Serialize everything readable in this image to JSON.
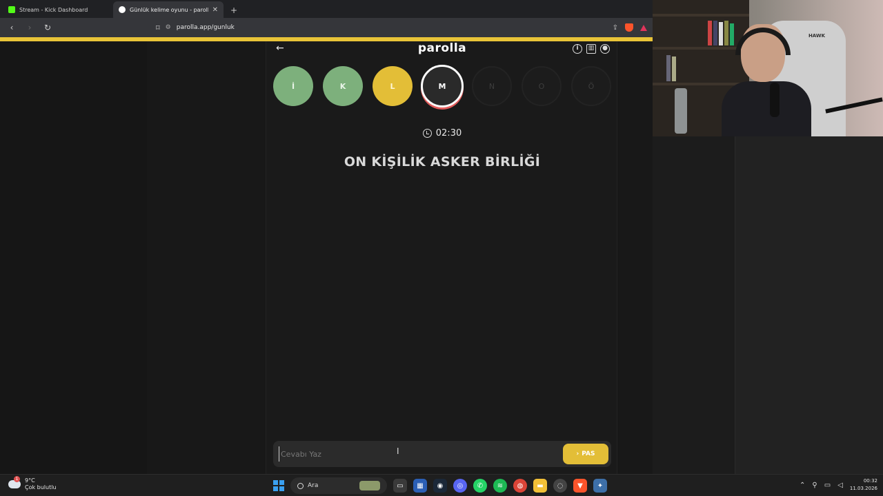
{
  "browser": {
    "tabs": [
      {
        "title": "Stream - Kick Dashboard",
        "active": false
      },
      {
        "title": "Günlük kelime oyunu - parolla -",
        "active": true
      }
    ],
    "new_tab": "+",
    "url": "parolla.app/gunluk"
  },
  "game": {
    "logo": "parolla",
    "letters": [
      {
        "char": "İ",
        "state": "correct"
      },
      {
        "char": "K",
        "state": "correct"
      },
      {
        "char": "L",
        "state": "passed"
      },
      {
        "char": "M",
        "state": "active"
      },
      {
        "char": "N",
        "state": "empty"
      },
      {
        "char": "O",
        "state": "empty"
      },
      {
        "char": "Ö",
        "state": "empty"
      }
    ],
    "timer": "02:30",
    "question": "ON KİŞİLİK ASKER BİRLİĞİ",
    "answer_placeholder": "Cevabı Yaz",
    "pass_label": "PAS"
  },
  "webcam": {
    "chair_brand": "HAWK"
  },
  "taskbar": {
    "weather_temp": "9°C",
    "weather_desc": "Çok bulutlu",
    "weather_badge": "1",
    "search_label": "Ara",
    "time": "00:32",
    "date": "11.03.2026"
  },
  "colors": {
    "correct": "#7db07c",
    "passed": "#e3be37",
    "accent": "#e9c438"
  }
}
